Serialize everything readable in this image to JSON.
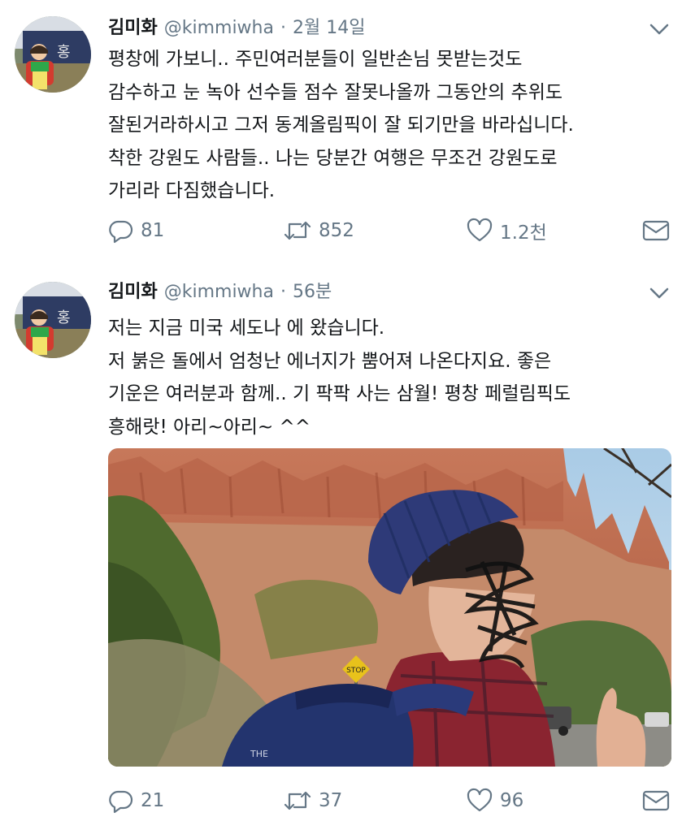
{
  "tweets": [
    {
      "name": "김미화",
      "handle": "@kimmiwha",
      "separator": "·",
      "time": "2월 14일",
      "lines": [
        "평창에 가보니.. 주민여러분들이 일반손님 못받는것도",
        "감수하고 눈 녹아 선수들 점수 잘못나올까 그동안의 추위도",
        "잘된거라하시고 그저 동계올림픽이 잘 되기만을 바라십니다.",
        "착한 강원도 사람들.. 나는 당분간 여행은 무조건 강원도로",
        "가리라 다짐했습니다."
      ],
      "replies": "81",
      "retweets": "852",
      "likes": "1.2천"
    },
    {
      "name": "김미화",
      "handle": "@kimmiwha",
      "separator": "·",
      "time": "56분",
      "lines": [
        "저는 지금 미국 세도나 에 왔습니다.",
        "저 붉은 돌에서 엄청난 에너지가 뿜어져 나온다지요.  좋은",
        "기운은 여러분과 함께.. 기 팍팍 사는 삼월! 평창 페럴림픽도",
        "흥해랏! 아리~아리~ ^^"
      ],
      "replies": "21",
      "retweets": "37",
      "likes": "96"
    }
  ],
  "photo": {
    "sign_text": "STOP",
    "backpack_text": "THE"
  },
  "icons": [
    "chevron-down-icon",
    "reply-icon",
    "retweet-icon",
    "like-icon",
    "direct-message-icon"
  ],
  "colors": {
    "text": "#14171a",
    "secondary": "#657786",
    "background": "#ffffff"
  }
}
